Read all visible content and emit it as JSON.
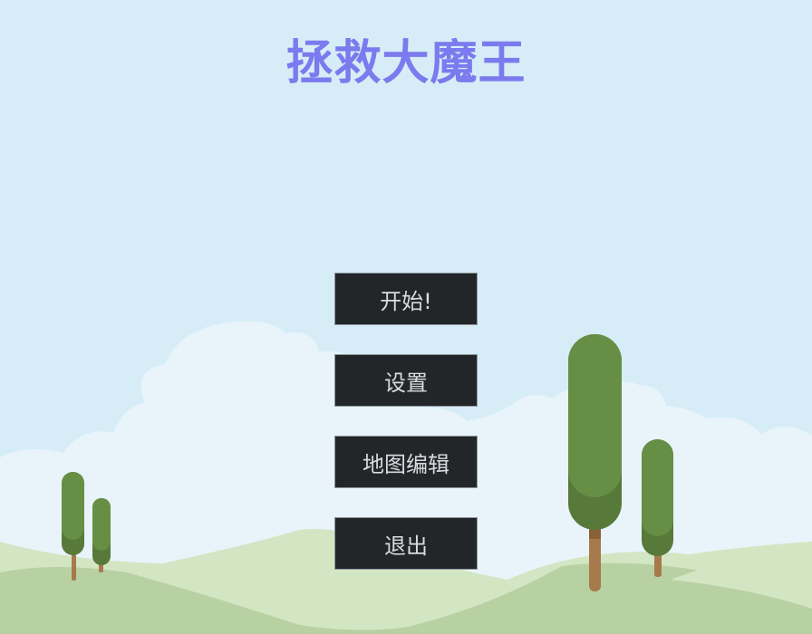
{
  "title": {
    "text": "拯救大魔王",
    "color": "#7b7aee"
  },
  "menu": {
    "start_label": "开始!",
    "settings_label": "设置",
    "map_editor_label": "地图编辑",
    "quit_label": "退出",
    "button_bg": "#232629",
    "button_text_color": "#d8dce0"
  },
  "colors": {
    "sky": "#d6edf7",
    "cloud": "#e8f4fa",
    "hill_light": "#d3e6c3",
    "hill_dark": "#b8d1a3",
    "tree_green": "#668f45",
    "tree_shade": "#57793a",
    "trunk": "#a77a4c"
  }
}
